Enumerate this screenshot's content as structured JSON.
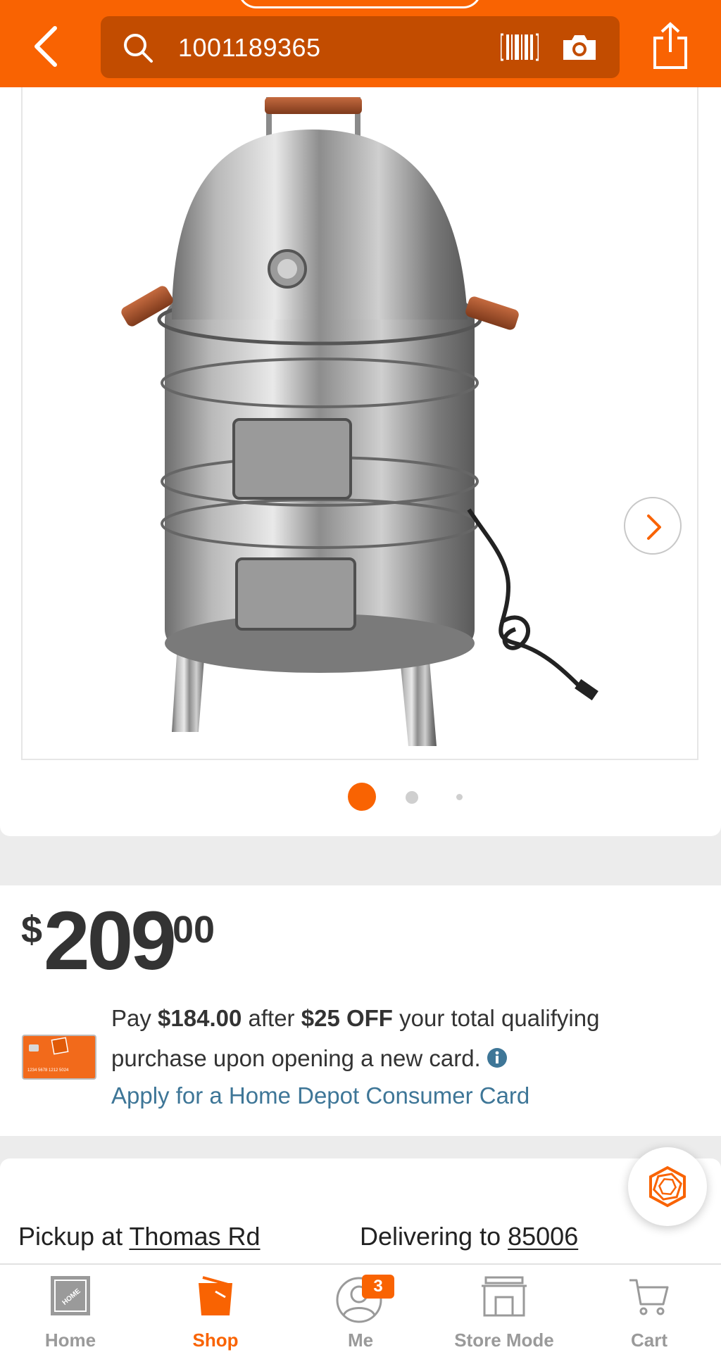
{
  "header": {
    "search_value": "1001189365",
    "icons": [
      "back-icon",
      "search-icon",
      "barcode-icon",
      "camera-icon",
      "share-icon"
    ],
    "accent_color": "#f96302"
  },
  "gallery": {
    "image_alt": "stainless steel vertical electric smoker",
    "current_index": 1,
    "total_images": 3
  },
  "price": {
    "dollar_sign": "$",
    "dollars": "209",
    "cents": "00"
  },
  "promo": {
    "pay_label": "Pay",
    "pay_amount": "$184.00",
    "after_label": "after",
    "discount": "$25 OFF",
    "rest_line1": "your total qualifying",
    "line2": "purchase upon opening a new card.",
    "apply_link": "Apply for a Home Depot Consumer Card",
    "card_number_text": "1234 5678 1212 5024"
  },
  "fulfillment": {
    "pickup_label": "Pickup at",
    "pickup_store": "Thomas Rd",
    "deliver_label": "Delivering to",
    "deliver_zip": "85006"
  },
  "nav": {
    "items": [
      {
        "label": "Home",
        "active": false
      },
      {
        "label": "Shop",
        "active": true
      },
      {
        "label": "Me",
        "active": false,
        "badge": "3"
      },
      {
        "label": "Store Mode",
        "active": false
      },
      {
        "label": "Cart",
        "active": false
      }
    ]
  }
}
